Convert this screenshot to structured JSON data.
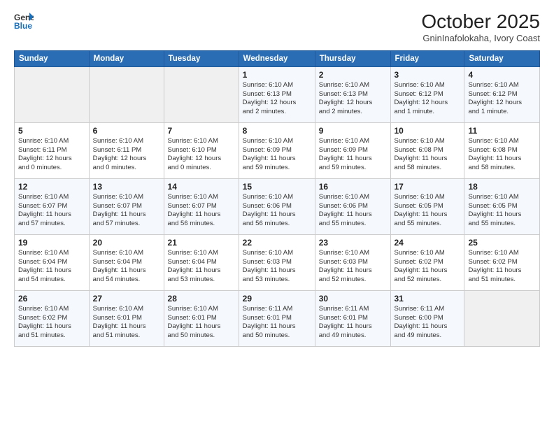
{
  "logo": {
    "line1": "General",
    "line2": "Blue"
  },
  "title": "October 2025",
  "subtitle": "GninInafolokaha, Ivory Coast",
  "header_days": [
    "Sunday",
    "Monday",
    "Tuesday",
    "Wednesday",
    "Thursday",
    "Friday",
    "Saturday"
  ],
  "weeks": [
    [
      {
        "day": "",
        "detail": ""
      },
      {
        "day": "",
        "detail": ""
      },
      {
        "day": "",
        "detail": ""
      },
      {
        "day": "1",
        "detail": "Sunrise: 6:10 AM\nSunset: 6:13 PM\nDaylight: 12 hours\nand 2 minutes."
      },
      {
        "day": "2",
        "detail": "Sunrise: 6:10 AM\nSunset: 6:13 PM\nDaylight: 12 hours\nand 2 minutes."
      },
      {
        "day": "3",
        "detail": "Sunrise: 6:10 AM\nSunset: 6:12 PM\nDaylight: 12 hours\nand 1 minute."
      },
      {
        "day": "4",
        "detail": "Sunrise: 6:10 AM\nSunset: 6:12 PM\nDaylight: 12 hours\nand 1 minute."
      }
    ],
    [
      {
        "day": "5",
        "detail": "Sunrise: 6:10 AM\nSunset: 6:11 PM\nDaylight: 12 hours\nand 0 minutes."
      },
      {
        "day": "6",
        "detail": "Sunrise: 6:10 AM\nSunset: 6:11 PM\nDaylight: 12 hours\nand 0 minutes."
      },
      {
        "day": "7",
        "detail": "Sunrise: 6:10 AM\nSunset: 6:10 PM\nDaylight: 12 hours\nand 0 minutes."
      },
      {
        "day": "8",
        "detail": "Sunrise: 6:10 AM\nSunset: 6:09 PM\nDaylight: 11 hours\nand 59 minutes."
      },
      {
        "day": "9",
        "detail": "Sunrise: 6:10 AM\nSunset: 6:09 PM\nDaylight: 11 hours\nand 59 minutes."
      },
      {
        "day": "10",
        "detail": "Sunrise: 6:10 AM\nSunset: 6:08 PM\nDaylight: 11 hours\nand 58 minutes."
      },
      {
        "day": "11",
        "detail": "Sunrise: 6:10 AM\nSunset: 6:08 PM\nDaylight: 11 hours\nand 58 minutes."
      }
    ],
    [
      {
        "day": "12",
        "detail": "Sunrise: 6:10 AM\nSunset: 6:07 PM\nDaylight: 11 hours\nand 57 minutes."
      },
      {
        "day": "13",
        "detail": "Sunrise: 6:10 AM\nSunset: 6:07 PM\nDaylight: 11 hours\nand 57 minutes."
      },
      {
        "day": "14",
        "detail": "Sunrise: 6:10 AM\nSunset: 6:07 PM\nDaylight: 11 hours\nand 56 minutes."
      },
      {
        "day": "15",
        "detail": "Sunrise: 6:10 AM\nSunset: 6:06 PM\nDaylight: 11 hours\nand 56 minutes."
      },
      {
        "day": "16",
        "detail": "Sunrise: 6:10 AM\nSunset: 6:06 PM\nDaylight: 11 hours\nand 55 minutes."
      },
      {
        "day": "17",
        "detail": "Sunrise: 6:10 AM\nSunset: 6:05 PM\nDaylight: 11 hours\nand 55 minutes."
      },
      {
        "day": "18",
        "detail": "Sunrise: 6:10 AM\nSunset: 6:05 PM\nDaylight: 11 hours\nand 55 minutes."
      }
    ],
    [
      {
        "day": "19",
        "detail": "Sunrise: 6:10 AM\nSunset: 6:04 PM\nDaylight: 11 hours\nand 54 minutes."
      },
      {
        "day": "20",
        "detail": "Sunrise: 6:10 AM\nSunset: 6:04 PM\nDaylight: 11 hours\nand 54 minutes."
      },
      {
        "day": "21",
        "detail": "Sunrise: 6:10 AM\nSunset: 6:04 PM\nDaylight: 11 hours\nand 53 minutes."
      },
      {
        "day": "22",
        "detail": "Sunrise: 6:10 AM\nSunset: 6:03 PM\nDaylight: 11 hours\nand 53 minutes."
      },
      {
        "day": "23",
        "detail": "Sunrise: 6:10 AM\nSunset: 6:03 PM\nDaylight: 11 hours\nand 52 minutes."
      },
      {
        "day": "24",
        "detail": "Sunrise: 6:10 AM\nSunset: 6:02 PM\nDaylight: 11 hours\nand 52 minutes."
      },
      {
        "day": "25",
        "detail": "Sunrise: 6:10 AM\nSunset: 6:02 PM\nDaylight: 11 hours\nand 51 minutes."
      }
    ],
    [
      {
        "day": "26",
        "detail": "Sunrise: 6:10 AM\nSunset: 6:02 PM\nDaylight: 11 hours\nand 51 minutes."
      },
      {
        "day": "27",
        "detail": "Sunrise: 6:10 AM\nSunset: 6:01 PM\nDaylight: 11 hours\nand 51 minutes."
      },
      {
        "day": "28",
        "detail": "Sunrise: 6:10 AM\nSunset: 6:01 PM\nDaylight: 11 hours\nand 50 minutes."
      },
      {
        "day": "29",
        "detail": "Sunrise: 6:11 AM\nSunset: 6:01 PM\nDaylight: 11 hours\nand 50 minutes."
      },
      {
        "day": "30",
        "detail": "Sunrise: 6:11 AM\nSunset: 6:01 PM\nDaylight: 11 hours\nand 49 minutes."
      },
      {
        "day": "31",
        "detail": "Sunrise: 6:11 AM\nSunset: 6:00 PM\nDaylight: 11 hours\nand 49 minutes."
      },
      {
        "day": "",
        "detail": ""
      }
    ]
  ]
}
